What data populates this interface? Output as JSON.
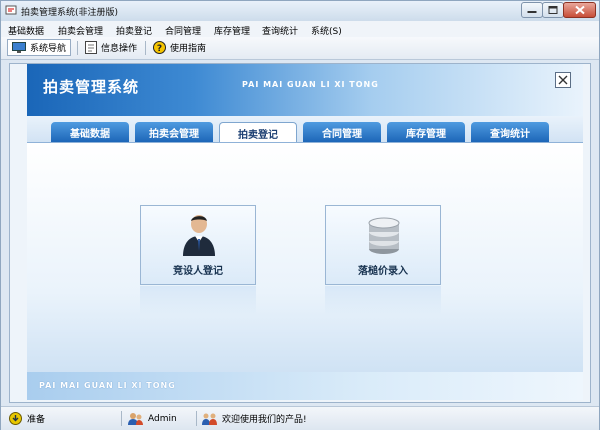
{
  "window": {
    "title": "拍卖管理系统(非注册版)"
  },
  "menu": [
    "基础数据",
    "拍卖会管理",
    "拍卖登记",
    "合同管理",
    "库存管理",
    "查询统计",
    "系统(S)"
  ],
  "toolbar": {
    "items": [
      {
        "label": "系统导航",
        "icon": "monitor-icon",
        "active": true
      },
      {
        "label": "信息操作",
        "icon": "document-icon",
        "active": false
      },
      {
        "label": "使用指南",
        "icon": "help-icon",
        "active": false
      }
    ]
  },
  "banner": {
    "title": "拍卖管理系统",
    "subtitle": "PAI MAI GUAN LI XI TONG"
  },
  "tabs": [
    {
      "label": "基础数据"
    },
    {
      "label": "拍卖会管理"
    },
    {
      "label": "拍卖登记",
      "active": true
    },
    {
      "label": "合同管理"
    },
    {
      "label": "库存管理"
    },
    {
      "label": "查询统计"
    }
  ],
  "functions": [
    {
      "label": "竞设人登记",
      "icon": "user-icon"
    },
    {
      "label": "落槌价录入",
      "icon": "database-icon"
    }
  ],
  "footer": {
    "text": "PAI MAI GUAN LI XI TONG"
  },
  "status": {
    "state": "准备",
    "user": "Admin",
    "message": "欢迎使用我们的产品!"
  },
  "colors": {
    "accent": "#1d66b8",
    "banner_start": "#1a66b8",
    "tab_active_text": "#1c3f72"
  }
}
